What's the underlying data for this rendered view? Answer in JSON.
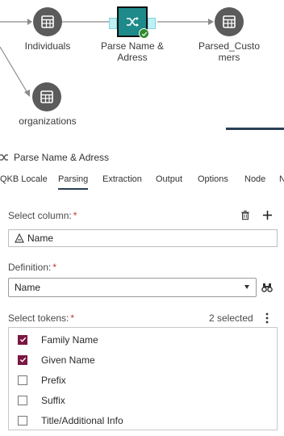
{
  "flow": {
    "nodes": {
      "individuals": {
        "label": "Individuals",
        "icon": "table-icon"
      },
      "parse": {
        "label_line1": "Parse Name &",
        "label_line2": "Adress",
        "icon": "parse-shuffle-icon",
        "status": "success"
      },
      "parsed_customers": {
        "label_line1": "Parsed_Custo",
        "label_line2": "mers",
        "icon": "table-icon"
      },
      "organizations": {
        "label": "organizations",
        "icon": "table-icon"
      }
    }
  },
  "panel": {
    "title": "Parse Name & Adress",
    "tabs": [
      {
        "label": "QKB Locale"
      },
      {
        "label": "Parsing",
        "active": true
      },
      {
        "label": "Extraction"
      },
      {
        "label": "Output"
      },
      {
        "label": "Options"
      },
      {
        "label": "Node"
      },
      {
        "label": "N"
      }
    ],
    "select_column": {
      "label": "Select column:",
      "required_mark": "*",
      "column": "Name"
    },
    "definition": {
      "label": "Definition:",
      "required_mark": "*",
      "value": "Name"
    },
    "tokens": {
      "label": "Select tokens:",
      "required_mark": "*",
      "selected_count": "2 selected",
      "items": [
        {
          "label": "Family Name",
          "checked": true
        },
        {
          "label": "Given Name",
          "checked": true
        },
        {
          "label": "Prefix",
          "checked": false
        },
        {
          "label": "Suffix",
          "checked": false
        },
        {
          "label": "Title/Additional Info",
          "checked": false
        }
      ]
    }
  },
  "colors": {
    "node": "#5b5b5b",
    "parse_node": "#1f8a8a",
    "checkbox_checked": "#7b1642",
    "success": "#2e8b2e",
    "required": "#c0392b"
  }
}
